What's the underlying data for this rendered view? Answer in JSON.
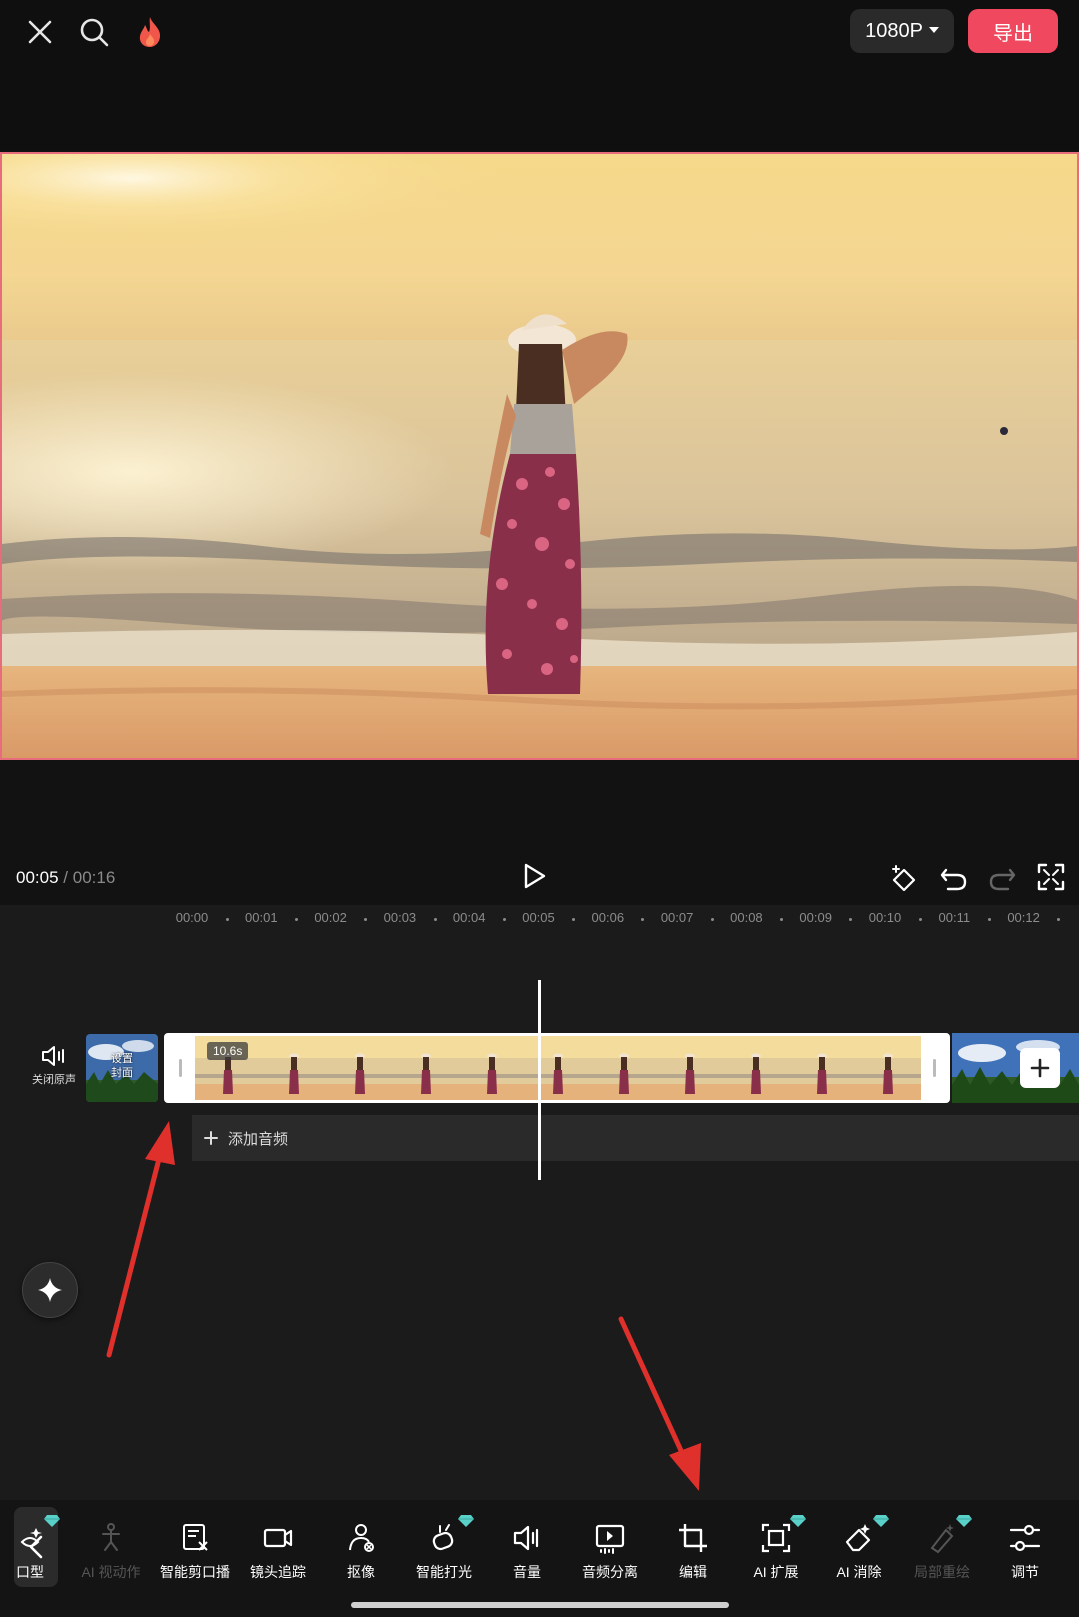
{
  "header": {
    "resolution_label": "1080P",
    "export_label": "导出"
  },
  "player": {
    "current_time": "00:05",
    "separator": "/",
    "total_time": "00:16"
  },
  "ruler": {
    "ticks": [
      "00:00",
      "00:01",
      "00:02",
      "00:03",
      "00:04",
      "00:05",
      "00:06",
      "00:07",
      "00:08",
      "00:09",
      "00:10",
      "00:11",
      "00:12"
    ]
  },
  "track": {
    "mute_label": "关闭原声",
    "cover_label_line1": "设置",
    "cover_label_line2": "封面",
    "clip_duration": "10.6s",
    "add_audio_label": "添加音频"
  },
  "toolbar": {
    "tools": [
      {
        "label": "口型",
        "icon": "lip-sync-icon",
        "premium": true,
        "disabled": false
      },
      {
        "label": "AI 视动作",
        "icon": "ai-motion-icon",
        "premium": false,
        "disabled": true
      },
      {
        "label": "智能剪口播",
        "icon": "smart-cut-icon",
        "premium": false,
        "disabled": false
      },
      {
        "label": "镜头追踪",
        "icon": "camera-track-icon",
        "premium": false,
        "disabled": false
      },
      {
        "label": "抠像",
        "icon": "cutout-icon",
        "premium": false,
        "disabled": false
      },
      {
        "label": "智能打光",
        "icon": "smart-light-icon",
        "premium": true,
        "disabled": false
      },
      {
        "label": "音量",
        "icon": "volume-icon",
        "premium": false,
        "disabled": false
      },
      {
        "label": "音频分离",
        "icon": "audio-split-icon",
        "premium": false,
        "disabled": false
      },
      {
        "label": "编辑",
        "icon": "crop-icon",
        "premium": false,
        "disabled": false
      },
      {
        "label": "AI 扩展",
        "icon": "ai-expand-icon",
        "premium": true,
        "disabled": false
      },
      {
        "label": "AI 消除",
        "icon": "ai-erase-icon",
        "premium": true,
        "disabled": false
      },
      {
        "label": "局部重绘",
        "icon": "inpaint-icon",
        "premium": true,
        "disabled": true
      },
      {
        "label": "调节",
        "icon": "adjust-icon",
        "premium": false,
        "disabled": false
      }
    ]
  },
  "colors": {
    "accent": "#f0485e",
    "preview_border": "#e86d7c",
    "annotation_arrow": "#e0302c",
    "premium_gem": "#5ad1c8"
  }
}
